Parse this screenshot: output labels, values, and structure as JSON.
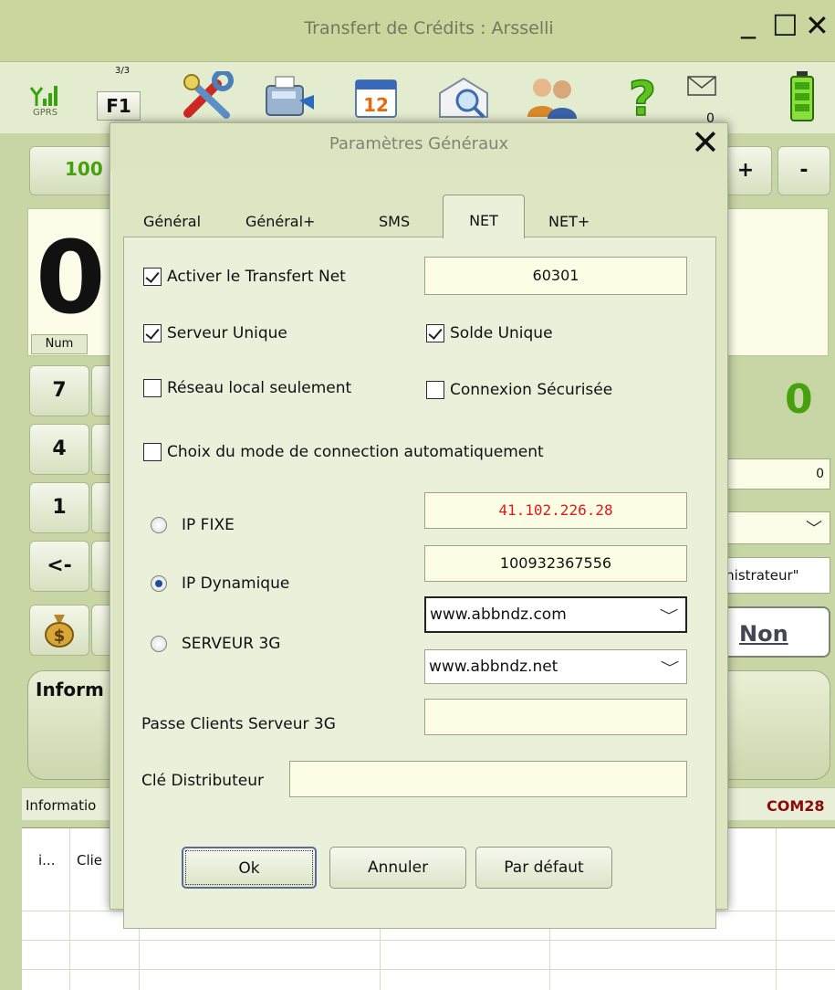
{
  "main_window": {
    "title": "Transfert de Crédits : Arsselli",
    "minimize": "_",
    "maximize": "☐",
    "close": "✕",
    "toolbar": {
      "signal_label": "GPRS",
      "sim_fraction": "3/3",
      "f1_label": "F1",
      "message_count": "0"
    },
    "amount_button": "100",
    "plus_label": "+",
    "minus_label": "-",
    "big_display": "0",
    "num_badge": "Num",
    "keypad": [
      "7",
      "4",
      "1",
      "<-"
    ],
    "right_value": "0",
    "zero_field": "0",
    "admin_field": "inistrateur\"",
    "non_button": "Non",
    "info_label": "Inform",
    "status_left": "Informatio",
    "status_right": "COM28",
    "grid_headers": [
      "i...",
      "Clie"
    ]
  },
  "dialog": {
    "title": "Paramètres Généraux",
    "close": "✕",
    "tabs": [
      "Général",
      "Général+",
      "SMS",
      "NET",
      "NET+"
    ],
    "active_tab": "NET",
    "checkboxes": {
      "activer_transfert_net": {
        "label": "Activer le Transfert Net",
        "checked": true
      },
      "serveur_unique": {
        "label": "Serveur Unique",
        "checked": true
      },
      "solde_unique": {
        "label": "Solde Unique",
        "checked": true
      },
      "reseau_local": {
        "label": "Réseau local seulement",
        "checked": false
      },
      "connexion_securisee": {
        "label": "Connexion Sécurisée",
        "checked": false
      },
      "choix_mode": {
        "label": "Choix du mode de connection automatiquement",
        "checked": false
      }
    },
    "fields": {
      "transfert_net_port": "60301",
      "ip_fixe_value": "41.102.226.28",
      "ip_dynamique_value": "100932367556",
      "serveur_combo_1": "www.abbndz.com",
      "serveur_combo_2": "www.abbndz.net",
      "passe_clients_value": "",
      "cle_distributeur_value": ""
    },
    "radios": {
      "ip_fixe": {
        "label": "IP FIXE",
        "selected": false
      },
      "ip_dynamique": {
        "label": "IP Dynamique",
        "selected": true
      },
      "serveur_3g": {
        "label": "SERVEUR 3G",
        "selected": false
      }
    },
    "labels": {
      "passe_clients": "Passe Clients Serveur 3G",
      "cle_distributeur": "Clé Distributeur"
    },
    "buttons": {
      "ok": "Ok",
      "annuler": "Annuler",
      "par_defaut": "Par défaut"
    },
    "colors": {
      "red_value": "#e01b1b",
      "accent_green": "#47a10f",
      "radio_selected": "#1b4f9c"
    }
  }
}
